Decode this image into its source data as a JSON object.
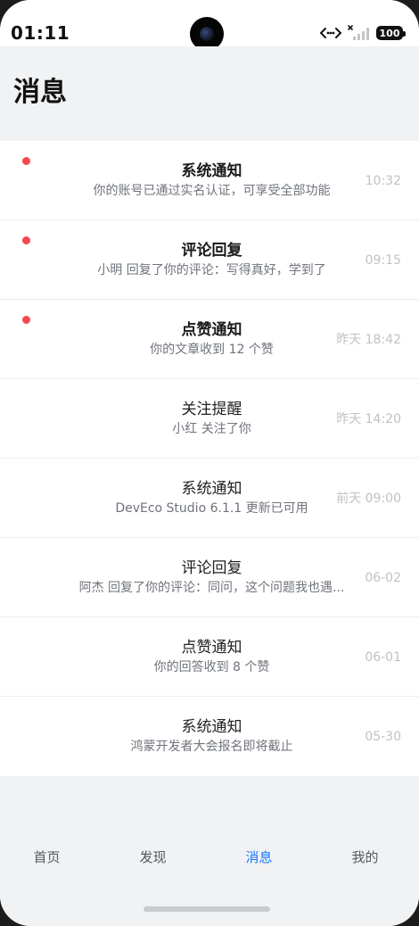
{
  "status_bar": {
    "time": "01:11",
    "battery": "100",
    "icons": [
      "data-transfer-icon",
      "no-signal-icon",
      "battery-icon"
    ]
  },
  "header": {
    "title": "消息"
  },
  "messages": [
    {
      "title": "系统通知",
      "desc": "你的账号已通过实名认证，可享受全部功能",
      "time": "10:32",
      "unread": true
    },
    {
      "title": "评论回复",
      "desc": "小明 回复了你的评论：写得真好，学到了",
      "time": "09:15",
      "unread": true
    },
    {
      "title": "点赞通知",
      "desc": "你的文章收到 12 个赞",
      "time": "昨天 18:42",
      "unread": true
    },
    {
      "title": "关注提醒",
      "desc": "小红 关注了你",
      "time": "昨天 14:20",
      "unread": false
    },
    {
      "title": "系统通知",
      "desc": "DevEco Studio 6.1.1 更新已可用",
      "time": "前天 09:00",
      "unread": false
    },
    {
      "title": "评论回复",
      "desc": "阿杰 回复了你的评论：同问，这个问题我也遇...",
      "time": "06-02",
      "unread": false
    },
    {
      "title": "点赞通知",
      "desc": "你的回答收到 8 个赞",
      "time": "06-01",
      "unread": false
    },
    {
      "title": "系统通知",
      "desc": "鸿蒙开发者大会报名即将截止",
      "time": "05-30",
      "unread": false
    }
  ],
  "tabbar": {
    "tabs": [
      {
        "label": "首页",
        "active": false
      },
      {
        "label": "发现",
        "active": false
      },
      {
        "label": "消息",
        "active": true
      },
      {
        "label": "我的",
        "active": false
      }
    ]
  },
  "colors": {
    "accent": "#1677ff",
    "unread_dot": "#f3484e",
    "background": "#f1f2f4"
  }
}
